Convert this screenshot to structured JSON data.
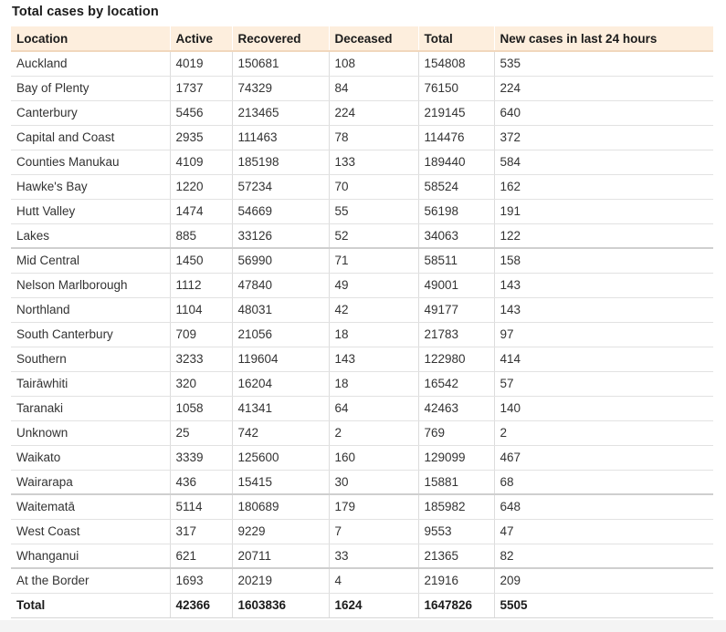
{
  "title": "Total cases by location",
  "headers": {
    "location": "Location",
    "active": "Active",
    "recovered": "Recovered",
    "deceased": "Deceased",
    "total": "Total",
    "new_cases": "New cases in last 24 hours"
  },
  "rows": [
    {
      "location": "Auckland",
      "active": "4019",
      "recovered": "150681",
      "deceased": "108",
      "total": "154808",
      "new_cases": "535"
    },
    {
      "location": "Bay of Plenty",
      "active": "1737",
      "recovered": "74329",
      "deceased": "84",
      "total": "76150",
      "new_cases": "224"
    },
    {
      "location": "Canterbury",
      "active": "5456",
      "recovered": "213465",
      "deceased": "224",
      "total": "219145",
      "new_cases": "640"
    },
    {
      "location": "Capital and Coast",
      "active": "2935",
      "recovered": "111463",
      "deceased": "78",
      "total": "114476",
      "new_cases": "372"
    },
    {
      "location": "Counties Manukau",
      "active": "4109",
      "recovered": "185198",
      "deceased": "133",
      "total": "189440",
      "new_cases": "584"
    },
    {
      "location": "Hawke's Bay",
      "active": "1220",
      "recovered": "57234",
      "deceased": "70",
      "total": "58524",
      "new_cases": "162"
    },
    {
      "location": "Hutt Valley",
      "active": "1474",
      "recovered": "54669",
      "deceased": "55",
      "total": "56198",
      "new_cases": "191"
    },
    {
      "location": "Lakes",
      "active": "885",
      "recovered": "33126",
      "deceased": "52",
      "total": "34063",
      "new_cases": "122"
    },
    {
      "location": "Mid Central",
      "active": "1450",
      "recovered": "56990",
      "deceased": "71",
      "total": "58511",
      "new_cases": "158"
    },
    {
      "location": "Nelson Marlborough",
      "active": "1112",
      "recovered": "47840",
      "deceased": "49",
      "total": "49001",
      "new_cases": "143"
    },
    {
      "location": "Northland",
      "active": "1104",
      "recovered": "48031",
      "deceased": "42",
      "total": "49177",
      "new_cases": "143"
    },
    {
      "location": "South Canterbury",
      "active": "709",
      "recovered": "21056",
      "deceased": "18",
      "total": "21783",
      "new_cases": "97"
    },
    {
      "location": "Southern",
      "active": "3233",
      "recovered": "119604",
      "deceased": "143",
      "total": "122980",
      "new_cases": "414"
    },
    {
      "location": "Tairāwhiti",
      "active": "320",
      "recovered": "16204",
      "deceased": "18",
      "total": "16542",
      "new_cases": "57"
    },
    {
      "location": "Taranaki",
      "active": "1058",
      "recovered": "41341",
      "deceased": "64",
      "total": "42463",
      "new_cases": "140"
    },
    {
      "location": "Unknown",
      "active": "25",
      "recovered": "742",
      "deceased": "2",
      "total": "769",
      "new_cases": "2"
    },
    {
      "location": "Waikato",
      "active": "3339",
      "recovered": "125600",
      "deceased": "160",
      "total": "129099",
      "new_cases": "467"
    },
    {
      "location": "Wairarapa",
      "active": "436",
      "recovered": "15415",
      "deceased": "30",
      "total": "15881",
      "new_cases": "68"
    },
    {
      "location": "Waitematā",
      "active": "5114",
      "recovered": "180689",
      "deceased": "179",
      "total": "185982",
      "new_cases": "648"
    },
    {
      "location": "West Coast",
      "active": "317",
      "recovered": "9229",
      "deceased": "7",
      "total": "9553",
      "new_cases": "47"
    },
    {
      "location": "Whanganui",
      "active": "621",
      "recovered": "20711",
      "deceased": "33",
      "total": "21365",
      "new_cases": "82"
    },
    {
      "location": "At the Border",
      "active": "1693",
      "recovered": "20219",
      "deceased": "4",
      "total": "21916",
      "new_cases": "209"
    }
  ],
  "totals": {
    "location": "Total",
    "active": "42366",
    "recovered": "1603836",
    "deceased": "1624",
    "total": "1647826",
    "new_cases": "5505"
  },
  "colors": {
    "header_background": "#fdeedd",
    "row_border": "#e2e2e2"
  }
}
